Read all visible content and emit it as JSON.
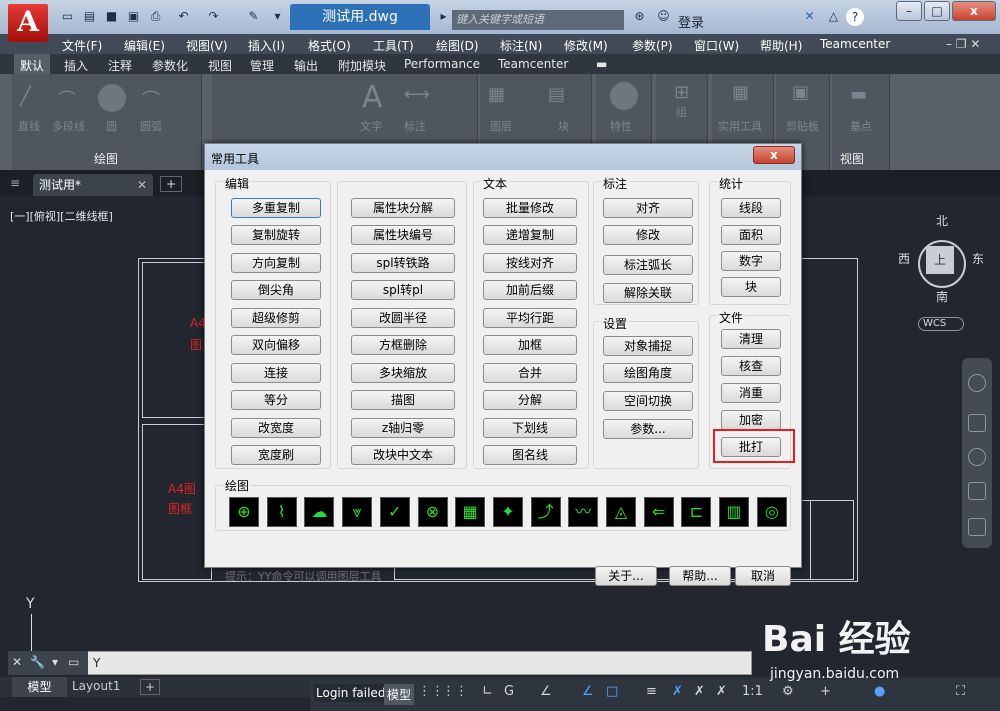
{
  "title_bar": {
    "app_logo": "A",
    "document_tab": "测试用.dwg",
    "search_placeholder": "键入关键字或短语",
    "login": "登录"
  },
  "window_controls": {
    "minimize": "–",
    "maximize": "□",
    "close": "x"
  },
  "menubar": [
    "文件(F)",
    "编辑(E)",
    "视图(V)",
    "插入(I)",
    "格式(O)",
    "工具(T)",
    "绘图(D)",
    "标注(N)",
    "修改(M)",
    "参数(P)",
    "窗口(W)",
    "帮助(H)",
    "Teamcenter"
  ],
  "ribbon_tabs": [
    "默认",
    "插入",
    "注释",
    "参数化",
    "视图",
    "管理",
    "输出",
    "附加模块",
    "Performance",
    "Teamcenter"
  ],
  "ribbon": {
    "draw_group": "绘图",
    "view_group": "视图",
    "tools": [
      "直线",
      "多段线",
      "圆",
      "圆弧",
      "文字",
      "标注",
      "图层",
      "块",
      "特性",
      "组",
      "实用工具",
      "剪贴板",
      "基点"
    ]
  },
  "doc_tab": {
    "name": "测试用*",
    "add": "+"
  },
  "viewport_label": "[一][俯视][二维线框]",
  "drawing_text": {
    "a4_1a": "A4",
    "a4_1b": "图",
    "a4_2a": "A4图",
    "a4_2b": "图框"
  },
  "viewcube": {
    "north": "北",
    "south": "南",
    "west": "西",
    "east": "东",
    "top": "上",
    "wcs": "WCS"
  },
  "axis_label": "Y",
  "command_line": {
    "prompt": "Y"
  },
  "bottom_tabs": {
    "model": "模型",
    "layout": "Layout1",
    "add": "+"
  },
  "status": {
    "login_failed": "Login failed.",
    "model": "模型",
    "scale": "1:1"
  },
  "watermark": {
    "logo": "Bai 经验",
    "url": "jingyan.baidu.com"
  },
  "dialog": {
    "title": "常用工具",
    "close": "x",
    "groups": {
      "edit": "编辑",
      "text": "文本",
      "dim": "标注",
      "stats": "统计",
      "settings": "设置",
      "file": "文件",
      "draw": "绘图"
    },
    "edit_col1": [
      "多重复制",
      "复制旋转",
      "方向复制",
      "倒尖角",
      "超级修剪",
      "双向偏移",
      "连接",
      "等分",
      "改宽度",
      "宽度刷"
    ],
    "edit_col2": [
      "属性块分解",
      "属性块编号",
      "spl转铁路",
      "spl转pl",
      "改圆半径",
      "方框删除",
      "多块缩放",
      "描图",
      "z轴归零",
      "改块中文本"
    ],
    "text_col": [
      "批量修改",
      "递增复制",
      "按线对齐",
      "加前后缀",
      "平均行距",
      "加框",
      "合并",
      "分解",
      "下划线",
      "图名线"
    ],
    "dim_col": [
      "对齐",
      "修改",
      "标注弧长",
      "解除关联"
    ],
    "settings_col": [
      "对象捕捉",
      "绘图角度",
      "空间切换",
      "参数..."
    ],
    "stats_col": [
      "线段",
      "面积",
      "数字",
      "块"
    ],
    "file_col": [
      "清理",
      "核查",
      "消重",
      "加密",
      "批打"
    ],
    "draw_icons": [
      "center-mark-icon",
      "break-line-icon",
      "cloud-icon",
      "weld-icon",
      "roughness-icon",
      "balloon-icon",
      "table-icon",
      "star-icon",
      "leader-icon",
      "wave-icon",
      "compass-icon",
      "arrow-icon",
      "component-icon",
      "number-icon",
      "spiral-icon"
    ],
    "tip": "提示：YY命令可以调用图层工具",
    "about": "关于...",
    "help": "帮助...",
    "cancel": "取消"
  }
}
